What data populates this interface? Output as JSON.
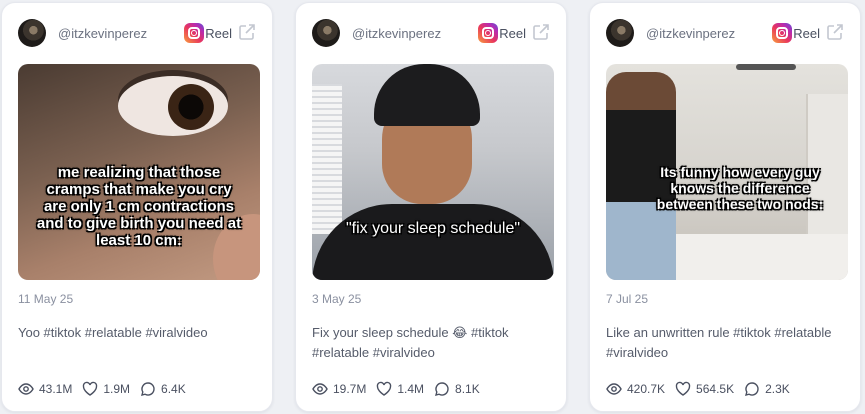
{
  "cards": [
    {
      "handle": "@itzkevinperez",
      "type_label": "Reel",
      "overlay_text": "me realizing that those cramps that make you cry are only 1 cm contractions and to give birth you need at least 10 cm:",
      "date": "11 May 25",
      "caption": "Yoo #tiktok #relatable #viralvideo",
      "views": "43.1M",
      "likes": "1.9M",
      "comments": "6.4K"
    },
    {
      "handle": "@itzkevinperez",
      "type_label": "Reel",
      "overlay_text": "\"fix your sleep schedule\"",
      "date": "3 May 25",
      "caption": "Fix your sleep schedule 😂 #tiktok #relatable #viralvideo",
      "views": "19.7M",
      "likes": "1.4M",
      "comments": "8.1K"
    },
    {
      "handle": "@itzkevinperez",
      "type_label": "Reel",
      "overlay_text": "Its funny how every guy knows the difference between these two nods:",
      "date": "7 Jul 25",
      "caption": "Like an unwritten rule #tiktok #relatable #viralvideo",
      "views": "420.7K",
      "likes": "564.5K",
      "comments": "2.3K"
    }
  ],
  "icons": {
    "platform": "instagram-icon",
    "external": "external-link-icon",
    "views": "eye-icon",
    "likes": "heart-icon",
    "comments": "comment-icon"
  }
}
